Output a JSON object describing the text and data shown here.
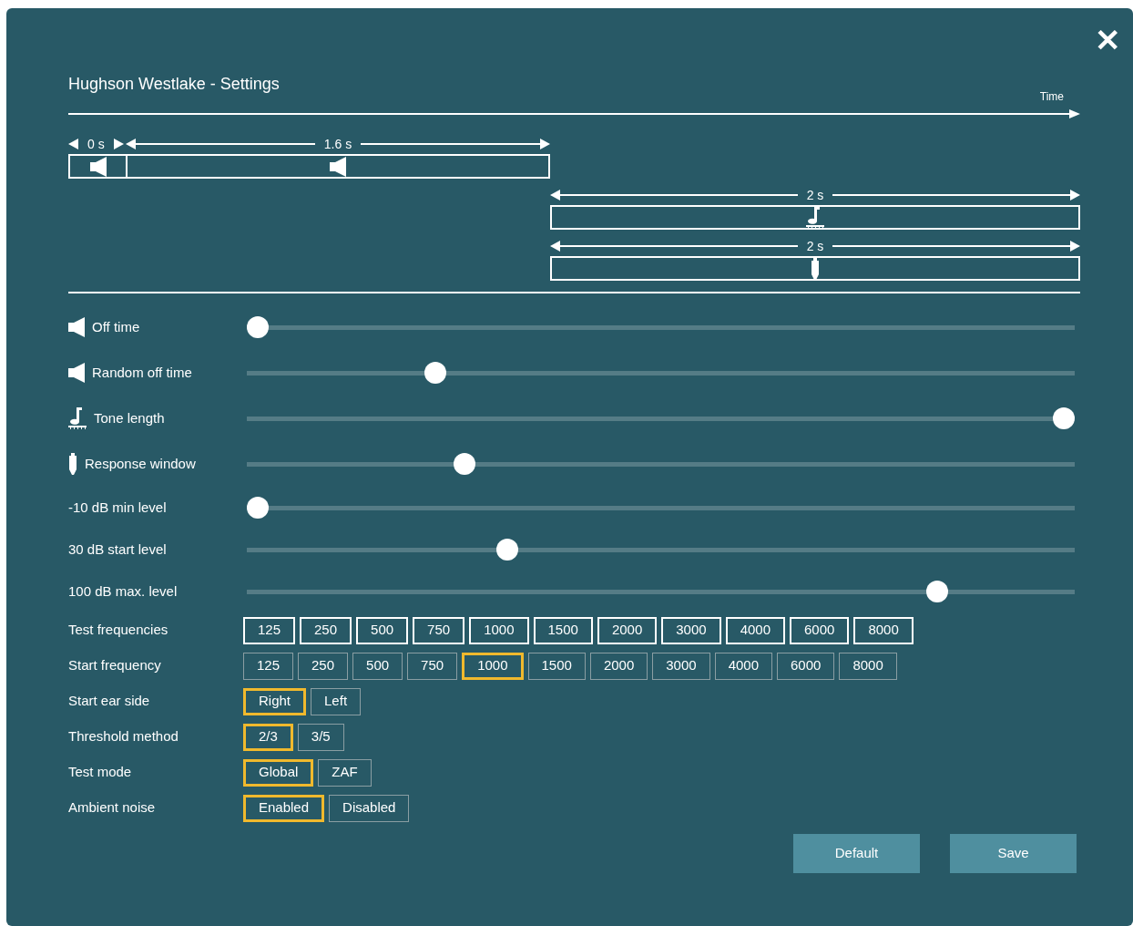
{
  "window": {
    "title": "Hughson Westlake - Settings",
    "close": "✕"
  },
  "timeline": {
    "axis_label": "Time",
    "segments": [
      {
        "kind": "off",
        "duration": "0 s"
      },
      {
        "kind": "random_off",
        "duration": "1.6 s"
      },
      {
        "kind": "tone",
        "duration": "2 s"
      },
      {
        "kind": "response",
        "duration": "2 s"
      }
    ]
  },
  "sliders": [
    {
      "kind": "off",
      "label": "Off time",
      "level": 0
    },
    {
      "kind": "random_off",
      "label": "Random off time",
      "level": 0.22
    },
    {
      "kind": "tone",
      "label": "Tone length",
      "level": 1
    },
    {
      "kind": "response",
      "label": "Response window",
      "level": 0.257
    },
    {
      "kind": "level",
      "label": "-10 dB min level",
      "level": 0
    },
    {
      "kind": "level",
      "label": "30 dB start level",
      "level": 0.31
    },
    {
      "kind": "level",
      "label": "100 dB max. level",
      "level": 0.843
    }
  ],
  "options": [
    {
      "kind": "multi",
      "label": "Test frequencies",
      "choices": [
        {
          "text": "125",
          "checked": true
        },
        {
          "text": "250",
          "checked": true
        },
        {
          "text": "500",
          "checked": true
        },
        {
          "text": "750",
          "checked": true
        },
        {
          "text": "1000",
          "checked": true
        },
        {
          "text": "1500",
          "checked": true
        },
        {
          "text": "2000",
          "checked": true
        },
        {
          "text": "3000",
          "checked": true
        },
        {
          "text": "4000",
          "checked": true
        },
        {
          "text": "6000",
          "checked": true
        },
        {
          "text": "8000",
          "checked": true
        }
      ]
    },
    {
      "kind": "single",
      "label": "Start frequency",
      "choices": [
        {
          "text": "125",
          "selected": false
        },
        {
          "text": "250",
          "selected": false
        },
        {
          "text": "500",
          "selected": false
        },
        {
          "text": "750",
          "selected": false
        },
        {
          "text": "1000",
          "selected": true
        },
        {
          "text": "1500",
          "selected": false
        },
        {
          "text": "2000",
          "selected": false
        },
        {
          "text": "3000",
          "selected": false
        },
        {
          "text": "4000",
          "selected": false
        },
        {
          "text": "6000",
          "selected": false
        },
        {
          "text": "8000",
          "selected": false
        }
      ]
    },
    {
      "kind": "single",
      "label": "Start ear side",
      "choices": [
        {
          "text": "Right",
          "selected": true
        },
        {
          "text": "Left",
          "selected": false
        }
      ]
    },
    {
      "kind": "single",
      "label": "Threshold method",
      "choices": [
        {
          "text": "2/3",
          "selected": true
        },
        {
          "text": "3/5",
          "selected": false
        }
      ]
    },
    {
      "kind": "single",
      "label": "Test mode",
      "choices": [
        {
          "text": "Global",
          "selected": true
        },
        {
          "text": "ZAF",
          "selected": false
        }
      ]
    },
    {
      "kind": "single",
      "label": "Ambient noise",
      "choices": [
        {
          "text": "Enabled",
          "selected": true
        },
        {
          "text": "Disabled",
          "selected": false
        }
      ]
    }
  ],
  "buttons": [
    "Default",
    "Save"
  ]
}
